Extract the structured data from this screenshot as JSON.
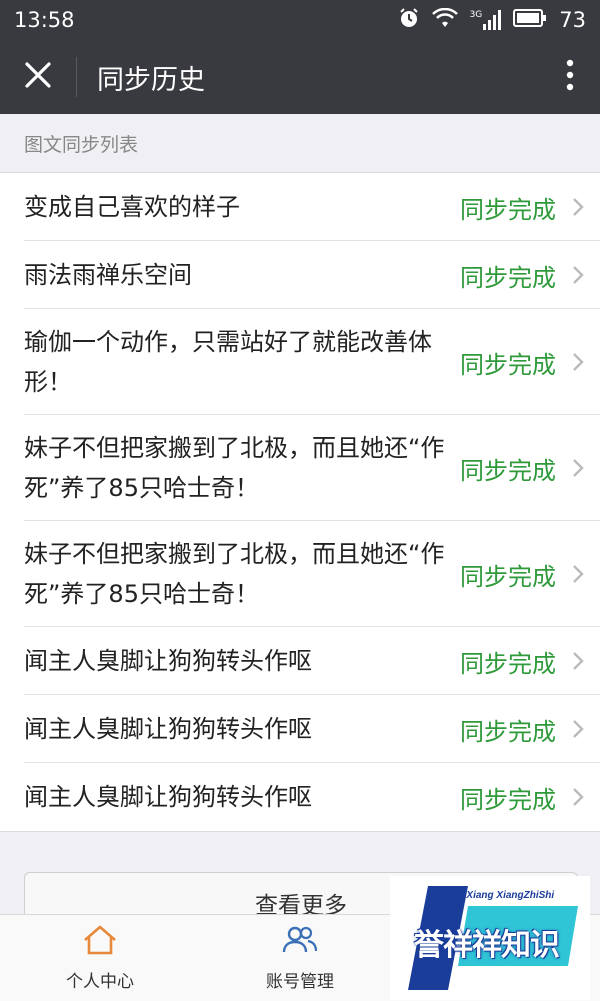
{
  "status_bar": {
    "time": "13:58",
    "network": "3G",
    "battery": "73",
    "icons": [
      "alarm-icon",
      "wifi-icon",
      "signal-icon",
      "battery-icon"
    ]
  },
  "header": {
    "title": "同步历史",
    "close_icon": "close-icon",
    "more_icon": "more-vertical-icon"
  },
  "section": {
    "label": "图文同步列表"
  },
  "list": {
    "items": [
      {
        "title": "变成自己喜欢的样子",
        "status": "同步完成"
      },
      {
        "title": "雨法雨禅乐空间",
        "status": "同步完成"
      },
      {
        "title": "瑜伽一个动作，只需站好了就能改善体形！",
        "status": "同步完成"
      },
      {
        "title": "妹子不但把家搬到了北极，而且她还“作死”养了85只哈士奇！",
        "status": "同步完成"
      },
      {
        "title": "妹子不但把家搬到了北极，而且她还“作死”养了85只哈士奇！",
        "status": "同步完成"
      },
      {
        "title": "闻主人臭脚让狗狗转头作呕",
        "status": "同步完成"
      },
      {
        "title": "闻主人臭脚让狗狗转头作呕",
        "status": "同步完成"
      },
      {
        "title": "闻主人臭脚让狗狗转头作呕",
        "status": "同步完成"
      }
    ]
  },
  "more_button": {
    "label": "查看更多"
  },
  "tabs": [
    {
      "label": "个人中心",
      "icon": "home-icon"
    },
    {
      "label": "账号管理",
      "icon": "users-icon"
    }
  ],
  "watermark": {
    "small_text": "YuXiang XiangZhiShi",
    "text": "誉祥祥知识"
  },
  "colors": {
    "header_bg": "#393a3f",
    "status_green": "#2e9a3a",
    "home_icon": "#e8883a",
    "users_icon": "#3b6fb6"
  }
}
